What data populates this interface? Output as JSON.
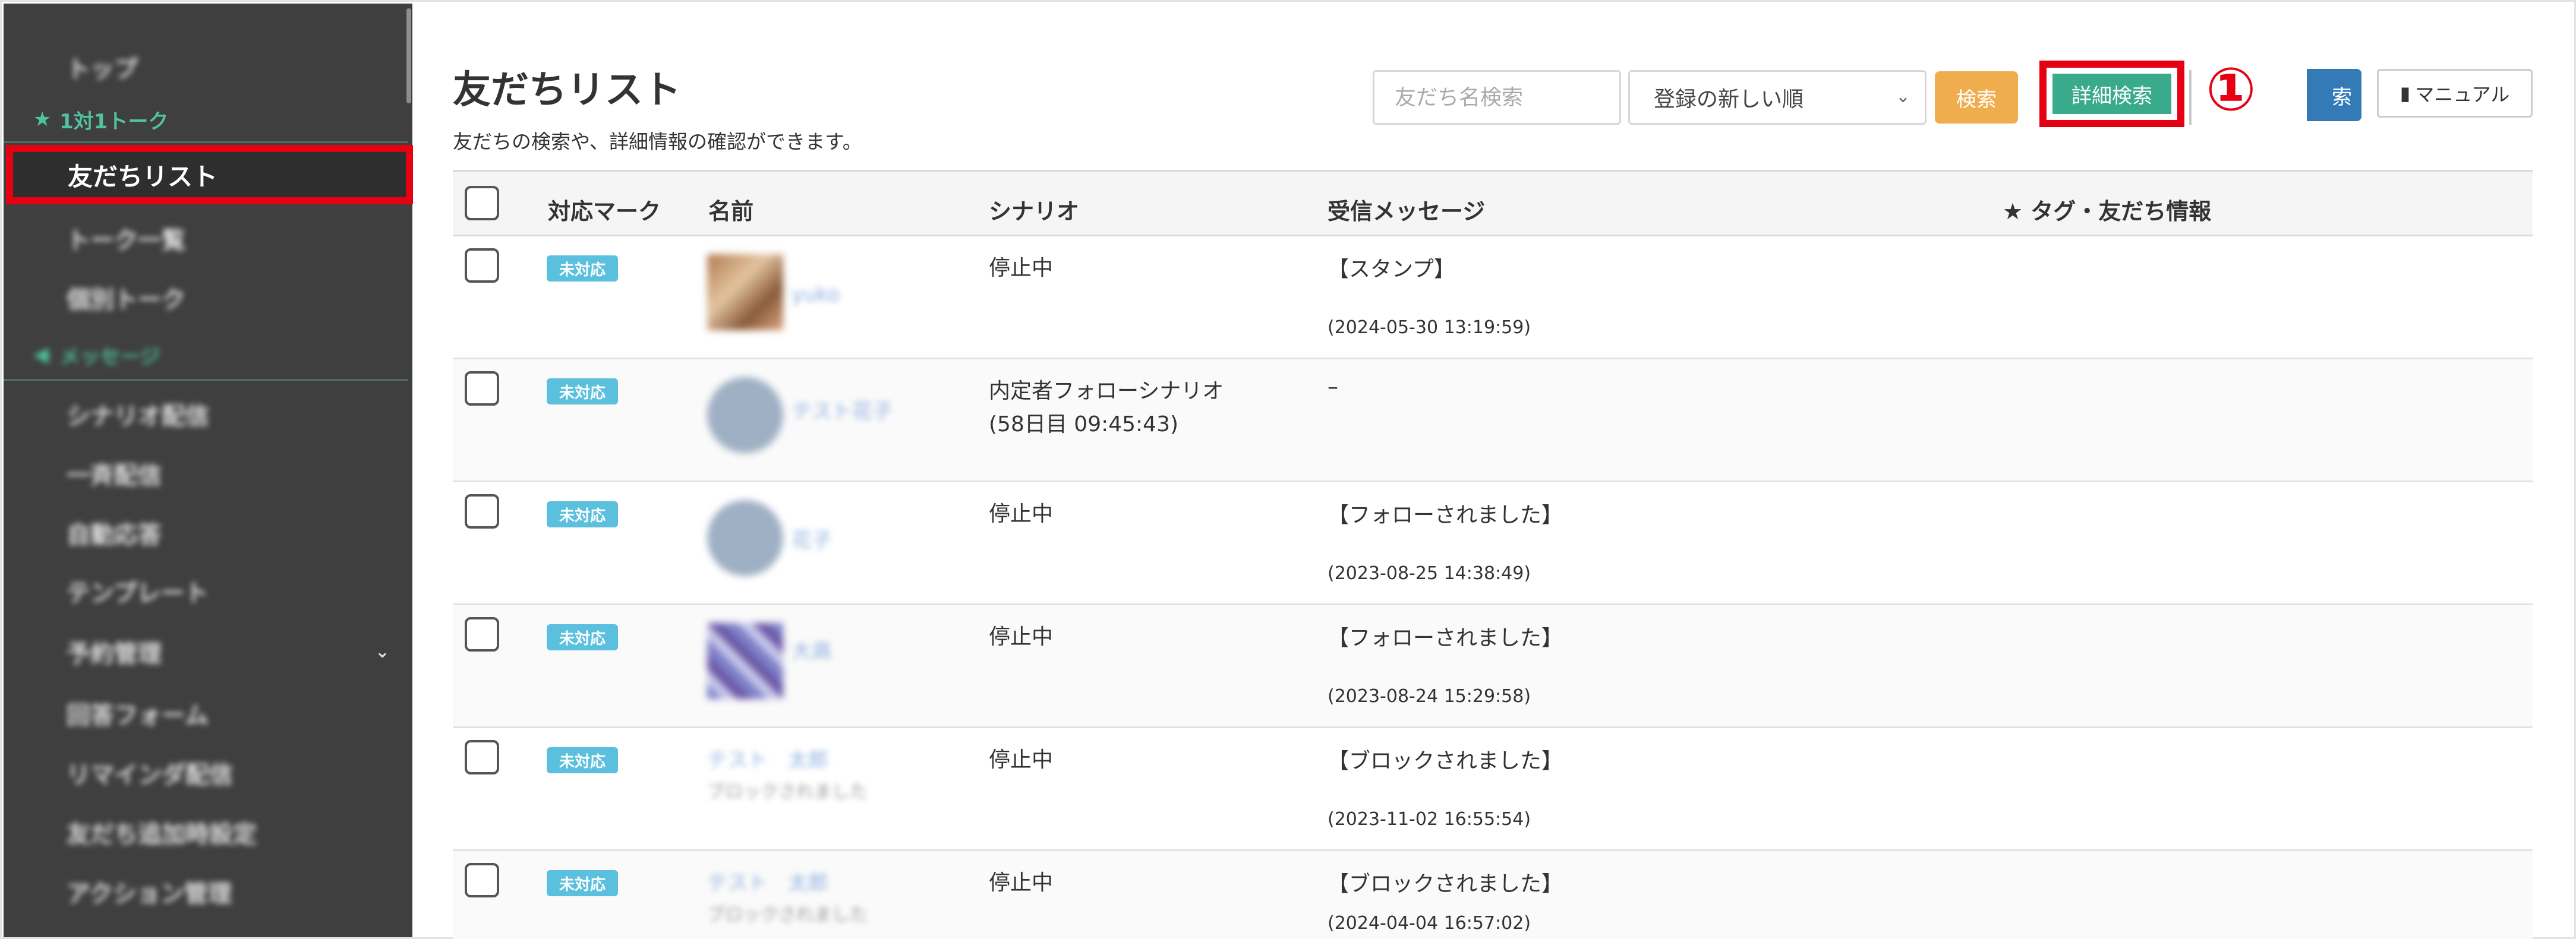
{
  "sidebar": {
    "items": [
      {
        "label": "トップ"
      },
      {
        "label": "1対1トーク"
      },
      {
        "label": "友だちリスト"
      },
      {
        "label": "トーク一覧"
      },
      {
        "label": "個別トーク"
      },
      {
        "label": "メッセージ"
      },
      {
        "label": "シナリオ配信"
      },
      {
        "label": "一斉配信"
      },
      {
        "label": "自動応答"
      },
      {
        "label": "テンプレート"
      },
      {
        "label": "予約管理"
      },
      {
        "label": "回答フォーム"
      },
      {
        "label": "リマインダ配信"
      },
      {
        "label": "友だち追加時設定"
      },
      {
        "label": "アクション管理"
      }
    ]
  },
  "header": {
    "title": "友だちリスト",
    "subtitle": "友だちの検索や、詳細情報の確認ができます。",
    "search_placeholder": "友だち名検索",
    "sort_value": "登録の新しい順",
    "search_button": "検索",
    "detail_search_button": "詳細検索",
    "annotation_number": "①",
    "blue_button_partial": "索",
    "manual_button": "マニュアル"
  },
  "table": {
    "columns": {
      "mark": "対応マーク",
      "name": "名前",
      "scenario": "シナリオ",
      "message": "受信メッセージ",
      "tags": "★ タグ・友だち情報"
    },
    "rows": [
      {
        "badge": "未対応",
        "name": "yuko",
        "scenario": "停止中",
        "scenario2": "",
        "message": "【スタンプ】",
        "time": "(2024-05-30 13:19:59)"
      },
      {
        "badge": "未対応",
        "name": "テスト花子",
        "scenario": "内定者フォローシナリオ",
        "scenario2": "(58日目 09:45:43)",
        "message": "–",
        "time": ""
      },
      {
        "badge": "未対応",
        "name": "花子",
        "scenario": "停止中",
        "scenario2": "",
        "message": "【フォローされました】",
        "time": "(2023-08-25 14:38:49)"
      },
      {
        "badge": "未対応",
        "name": "大高",
        "scenario": "停止中",
        "scenario2": "",
        "message": "【フォローされました】",
        "time": "(2023-08-24 15:29:58)"
      },
      {
        "badge": "未対応",
        "name": "テスト　太郎",
        "name_sub": "ブロックされました",
        "scenario": "停止中",
        "scenario2": "",
        "message": "【ブロックされました】",
        "time": "(2023-11-02 16:55:54)"
      },
      {
        "badge": "未対応",
        "name": "テスト　太郎",
        "name_sub": "ブロックされました",
        "scenario": "停止中",
        "scenario2": "",
        "message": "【ブロックされました】",
        "time": "(2024-04-04 16:57:02)"
      }
    ]
  },
  "colors": {
    "sidebar_bg": "#3f3f3f",
    "accent_green": "#3aaa8d",
    "highlight_red": "#e50012",
    "badge_blue": "#5bc0de",
    "search_orange": "#f0ad4e"
  }
}
